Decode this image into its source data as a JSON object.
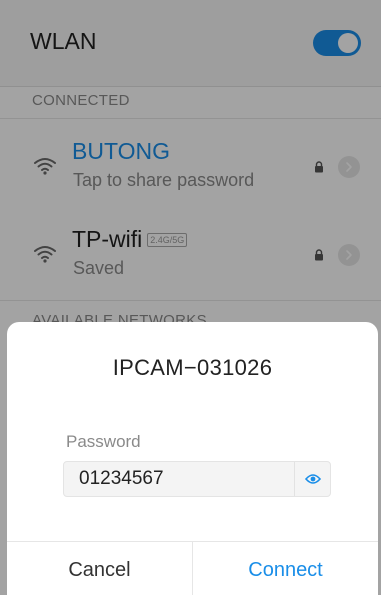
{
  "header": {
    "title": "WLAN",
    "wlan_enabled": true
  },
  "sections": {
    "connected_label": "CONNECTED",
    "available_label": "AVAILABLE NETWORKS"
  },
  "networks": [
    {
      "name": "BUTONG",
      "status": "Tap to share password",
      "badge": "",
      "secured": true,
      "connected": true
    },
    {
      "name": "TP-wifi",
      "status": "Saved",
      "badge": "2.4G/5G",
      "secured": true,
      "connected": false
    }
  ],
  "dialog": {
    "title": "IPCAM−031026",
    "password_label": "Password",
    "password_value": "01234567",
    "cancel_label": "Cancel",
    "connect_label": "Connect"
  },
  "colors": {
    "accent": "#1a8ee8",
    "text": "#222222",
    "muted": "#8a8a8a"
  },
  "icons": {
    "wifi": "wifi-icon",
    "lock": "lock-icon",
    "detail": "chevron-right-icon",
    "reveal": "eye-icon"
  }
}
